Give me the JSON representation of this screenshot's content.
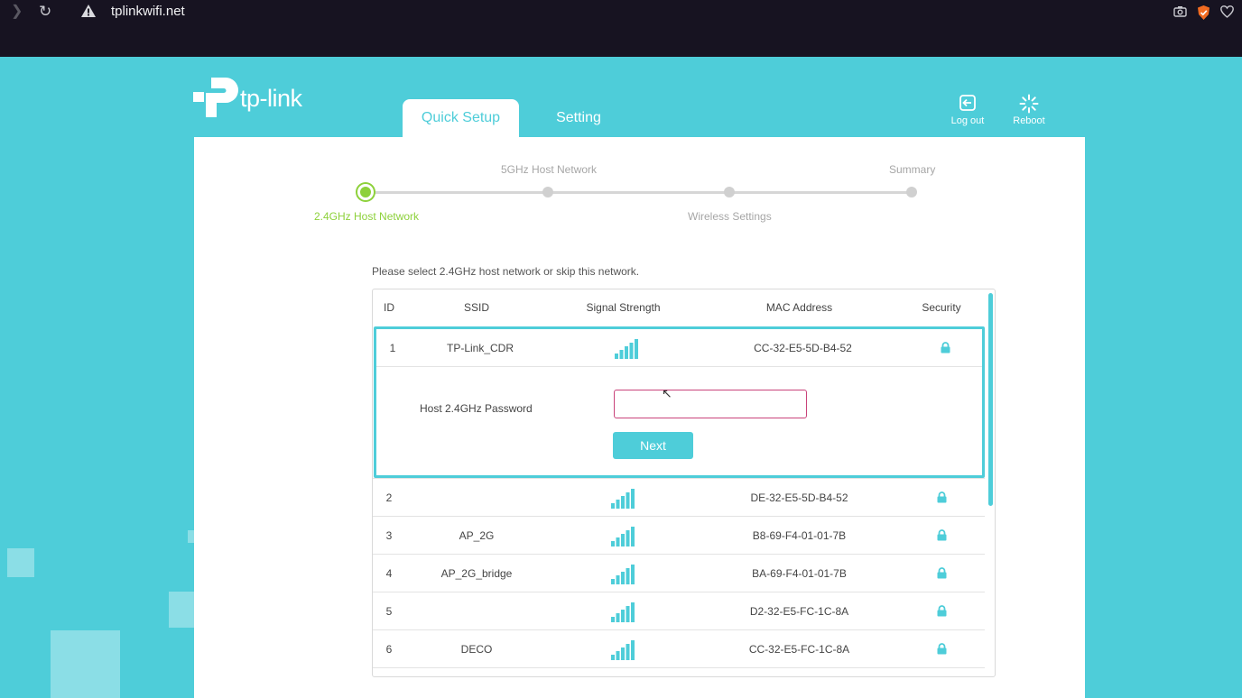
{
  "browser": {
    "url": "tplinkwifi.net"
  },
  "header": {
    "brand": "tp-link",
    "tabs": [
      {
        "label": "Quick Setup",
        "active": true
      },
      {
        "label": "Setting",
        "active": false
      }
    ],
    "logout_label": "Log out",
    "reboot_label": "Reboot"
  },
  "stepper": [
    "2.4GHz Host Network",
    "5GHz Host Network",
    "Wireless Settings",
    "Summary"
  ],
  "current_step": 1,
  "instruction": "Please select 2.4GHz host network or skip this network.",
  "table": {
    "columns": [
      "ID",
      "SSID",
      "Signal Strength",
      "MAC Address",
      "Security"
    ],
    "rows": [
      {
        "id": "1",
        "ssid": "TP-Link_CDR",
        "signal_bars": 5,
        "mac": "CC-32-E5-5D-B4-52",
        "secured": true,
        "selected": true
      },
      {
        "id": "2",
        "ssid": "",
        "signal_bars": 5,
        "mac": "DE-32-E5-5D-B4-52",
        "secured": true
      },
      {
        "id": "3",
        "ssid": "AP_2G",
        "signal_bars": 5,
        "mac": "B8-69-F4-01-01-7B",
        "secured": true
      },
      {
        "id": "4",
        "ssid": "AP_2G_bridge",
        "signal_bars": 5,
        "mac": "BA-69-F4-01-01-7B",
        "secured": true
      },
      {
        "id": "5",
        "ssid": "",
        "signal_bars": 5,
        "mac": "D2-32-E5-FC-1C-8A",
        "secured": true
      },
      {
        "id": "6",
        "ssid": "DECO",
        "signal_bars": 5,
        "mac": "CC-32-E5-FC-1C-8A",
        "secured": true
      }
    ]
  },
  "password": {
    "label": "Host 2.4GHz Password",
    "value": "",
    "next_label": "Next"
  },
  "colors": {
    "accent": "#4ecdd9",
    "step_active": "#8dd13a",
    "browser_bar": "#171321"
  },
  "icons": [
    "forward-icon",
    "reload-icon",
    "warning-icon",
    "camera-icon",
    "brave-shield-icon",
    "heart-icon",
    "logout-icon",
    "reboot-icon",
    "signal-strength-icon",
    "lock-icon"
  ]
}
